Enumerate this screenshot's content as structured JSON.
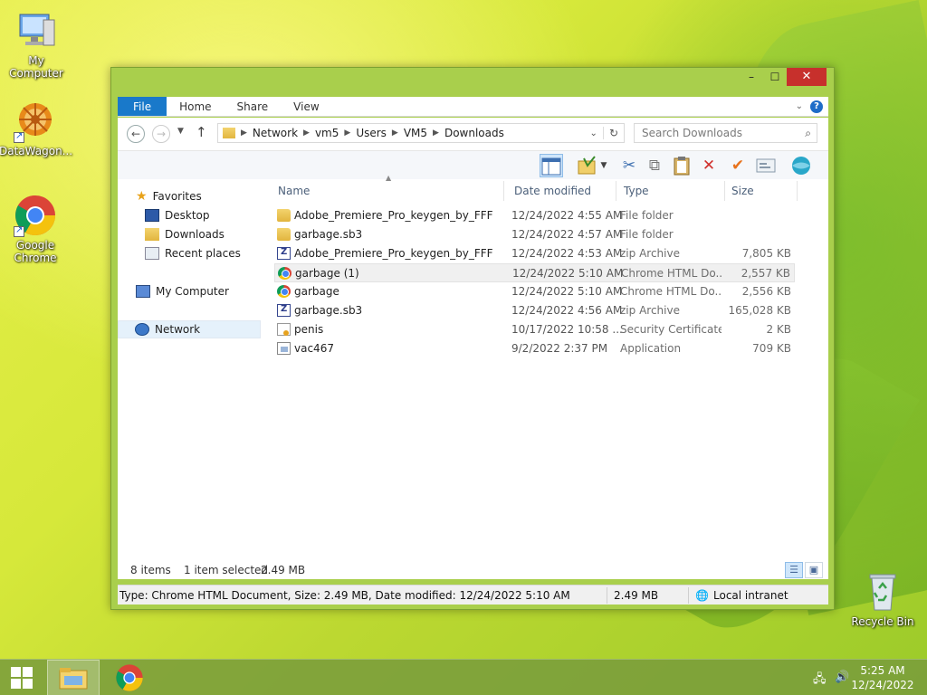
{
  "desktop": {
    "icons": [
      {
        "label": "My Computer",
        "icon": "computer-icon"
      },
      {
        "label": "DataWagon...",
        "icon": "datawagon-icon"
      },
      {
        "label": "Google Chrome",
        "icon": "chrome-icon"
      },
      {
        "label": "Recycle Bin",
        "icon": "recycle-bin-icon"
      }
    ]
  },
  "window": {
    "controls": {
      "minimize": "–",
      "maximize": "☐",
      "close": "✕"
    },
    "ribbon_tabs": [
      "File",
      "Home",
      "Share",
      "View"
    ],
    "address": {
      "crumbs": [
        "Network",
        "vm5",
        "Users",
        "VM5",
        "Downloads"
      ],
      "search_placeholder": "Search Downloads"
    },
    "nav_pane": {
      "favorites": "Favorites",
      "favorites_items": [
        "Desktop",
        "Downloads",
        "Recent places"
      ],
      "my_computer": "My Computer",
      "network": "Network"
    },
    "columns": [
      "Name",
      "Date modified",
      "Type",
      "Size"
    ],
    "files": [
      {
        "name": "Adobe_Premiere_Pro_keygen_by_FFF",
        "date": "12/24/2022 4:55 AM",
        "type": "File folder",
        "size": "",
        "icon": "folder-icon"
      },
      {
        "name": "garbage.sb3",
        "date": "12/24/2022 4:57 AM",
        "type": "File folder",
        "size": "",
        "icon": "folder-icon"
      },
      {
        "name": "Adobe_Premiere_Pro_keygen_by_FFF",
        "date": "12/24/2022 4:53 AM",
        "type": "zip Archive",
        "size": "7,805 KB",
        "icon": "zip-icon"
      },
      {
        "name": "garbage (1)",
        "date": "12/24/2022 5:10 AM",
        "type": "Chrome HTML Do...",
        "size": "2,557 KB",
        "icon": "chrome-html-icon"
      },
      {
        "name": "garbage",
        "date": "12/24/2022 5:10 AM",
        "type": "Chrome HTML Do...",
        "size": "2,556 KB",
        "icon": "chrome-html-icon"
      },
      {
        "name": "garbage.sb3",
        "date": "12/24/2022 4:56 AM",
        "type": "zip Archive",
        "size": "165,028 KB",
        "icon": "zip-icon"
      },
      {
        "name": "penis",
        "date": "10/17/2022 10:58 ...",
        "type": "Security Certificate",
        "size": "2 KB",
        "icon": "certificate-icon"
      },
      {
        "name": "vac467",
        "date": "9/2/2022 2:37 PM",
        "type": "Application",
        "size": "709 KB",
        "icon": "application-icon"
      }
    ],
    "status": {
      "items": "8 items",
      "selected": "1 item selected",
      "selected_size": "2.49 MB"
    },
    "details": {
      "text": "Type: Chrome HTML Document, Size: 2.49 MB, Date modified: 12/24/2022 5:10 AM",
      "size": "2.49 MB",
      "zone": "Local intranet"
    }
  },
  "taskbar": {
    "time": "5:25 AM",
    "date": "12/24/2022"
  },
  "colors": {
    "accent": "#1979ca",
    "window_frame": "#a9cf4c",
    "close_button": "#c7302c"
  }
}
